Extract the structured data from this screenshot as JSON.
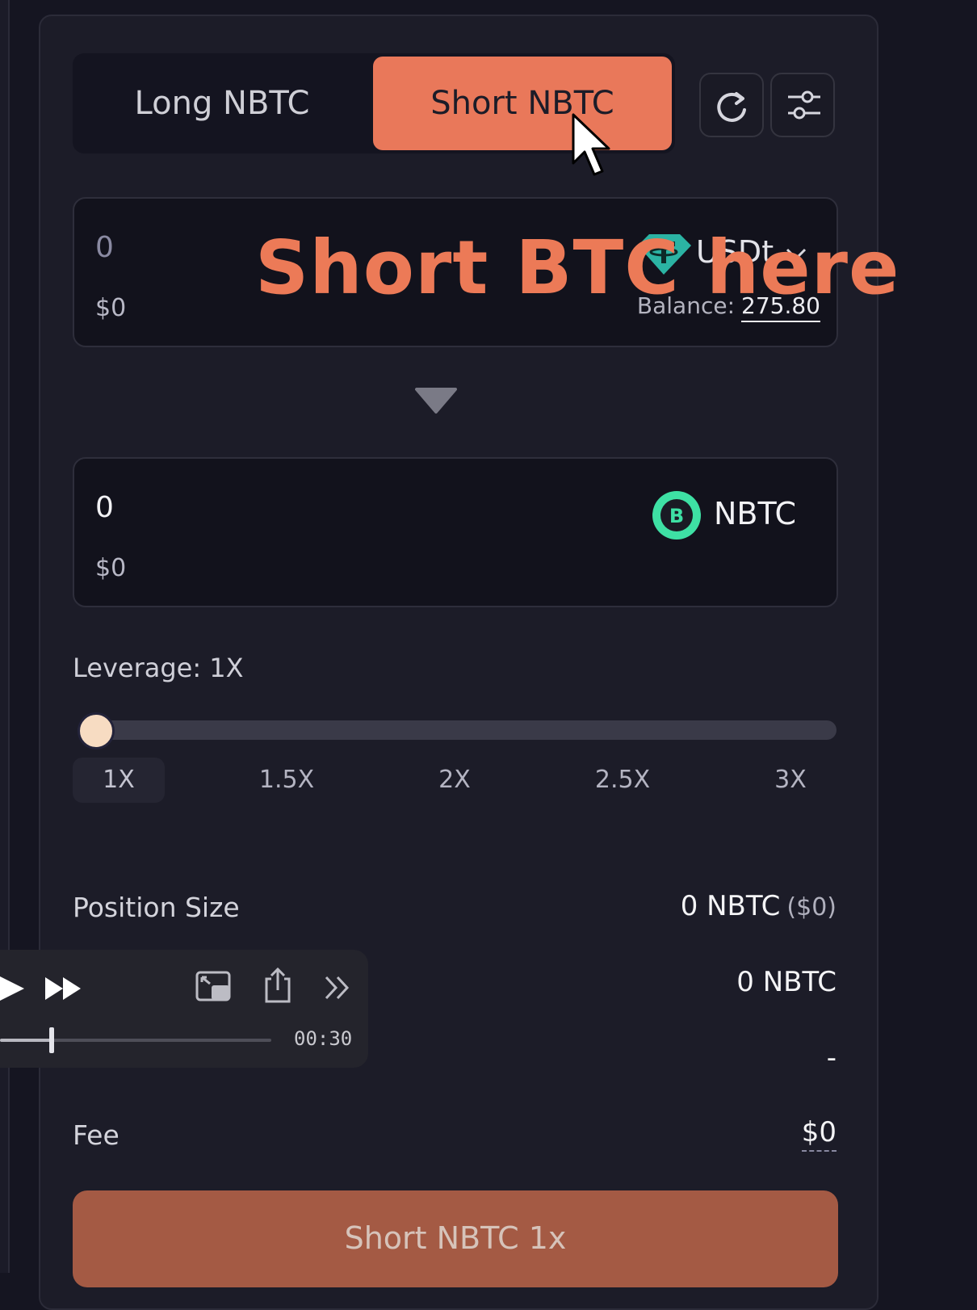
{
  "tabs": {
    "long_label": "Long NBTC",
    "short_label": "Short NBTC",
    "active": "short"
  },
  "toolbar": {
    "refresh_icon": "refresh-icon",
    "settings_icon": "sliders-icon"
  },
  "pay": {
    "amount": "0",
    "usd_value": "$0",
    "token": "USDt",
    "balance_label": "Balance:",
    "balance_value": "275.80"
  },
  "overlay": {
    "caption": "Short BTC here"
  },
  "receive": {
    "amount": "0",
    "usd_value": "$0",
    "token": "NBTC"
  },
  "leverage": {
    "label": "Leverage: 1X",
    "options": [
      "1X",
      "1.5X",
      "2X",
      "2.5X",
      "3X"
    ],
    "selected": "1X",
    "slider_fraction": 0
  },
  "rows": {
    "position_size_label": "Position Size",
    "position_size_value": "0 NBTC",
    "position_size_usd": "($0)",
    "second_value": "0 NBTC",
    "liq_value": "-",
    "fee_label": "Fee",
    "fee_value": "$0"
  },
  "cta": {
    "label": "Short NBTC 1x"
  },
  "player": {
    "time": "00:30",
    "progress_fraction": 0.19
  },
  "colors": {
    "accent": "#e9785a",
    "btc_green": "#3ee0a4",
    "usdt_teal": "#2bb3a3"
  }
}
